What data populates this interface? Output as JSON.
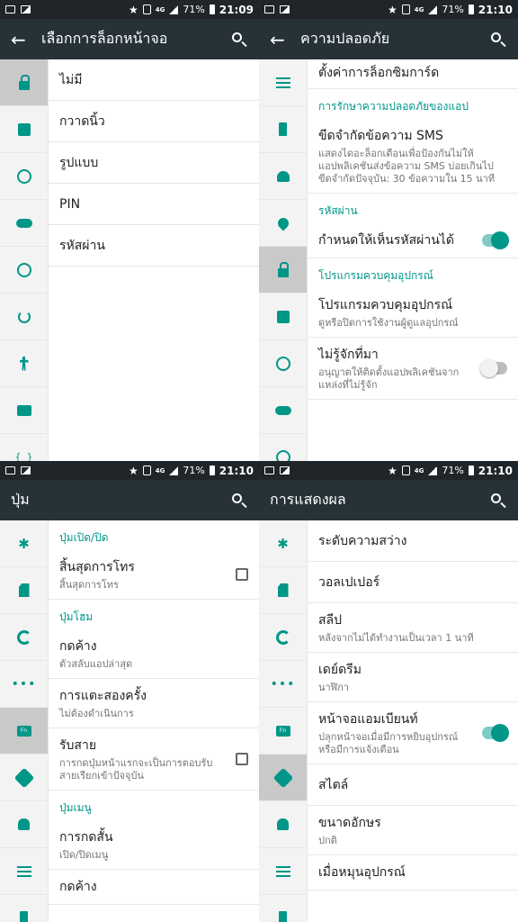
{
  "status": {
    "time": "21:09",
    "time2": "21:10",
    "battery": "71%",
    "net": "4G"
  },
  "screen1": {
    "title": "เลือกการล็อกหน้าจอ",
    "options": [
      "ไม่มี",
      "กวาดนิ้ว",
      "รูปแบบ",
      "PIN",
      "รหัสผ่าน"
    ]
  },
  "screen2": {
    "title": "ความปลอดภัย",
    "top_item": "ตั้งค่าการล็อกซิมการ์ด",
    "sec_app": "การรักษาความปลอดภัยของแอป",
    "sms_title": "ขีดจำกัดข้อความ SMS",
    "sms_sub": "แสดงไดอะล็อกเตือนเพื่อป้องกันไม่ให้แอปพลิเคชันส่งข้อความ SMS บ่อยเกินไป ขีดจำกัดปัจจุบัน: 30 ข้อความใน 15 นาที",
    "sec_pass": "รหัสผ่าน",
    "show_pass": "กำหนดให้เห็นรหัสผ่านได้",
    "sec_admin": "โปรแกรมควบคุมอุปกรณ์",
    "admin_title": "โปรแกรมควบคุมอุปกรณ์",
    "admin_sub": "ดูหรือปิดการใช้งานผู้ดูแลอุปกรณ์",
    "unknown_title": "ไม่รู้จักที่มา",
    "unknown_sub": "อนุญาตให้ติดตั้งแอปพลิเคชันจากแหล่งที่ไม่รู้จัก"
  },
  "screen3": {
    "title": "ปุ่ม",
    "sec_power": "ปุ่มเปิด/ปิด",
    "end_call": "สิ้นสุดการโทร",
    "end_call_sub": "สิ้นสุดการโทร",
    "sec_home": "ปุ่มโฮม",
    "long_press": "กดค้าง",
    "long_press_sub": "ตัวสลับแอปล่าสุด",
    "double_tap": "การแตะสองครั้ง",
    "double_tap_sub": "ไม่ต้องดำเนินการ",
    "answer": "รับสาย",
    "answer_sub": "การกดปุ่มหน้าแรกจะเป็นการตอบรับสายเรียกเข้าปัจจุบัน",
    "sec_menu": "ปุ่มเมนู",
    "short_press": "การกดสั้น",
    "short_press_sub": "เปิด/ปิดเมนู",
    "long_press2": "กดค้าง"
  },
  "screen4": {
    "title": "การแสดงผล",
    "brightness": "ระดับความสว่าง",
    "wallpaper": "วอลเปเปอร์",
    "sleep": "สลีป",
    "sleep_sub": "หลังจากไม่ได้ทำงานเป็นเวลา 1 นาที",
    "daydream": "เดย์ดรีม",
    "daydream_sub": "นาฬิกา",
    "ambient": "หน้าจอแอมเบียนท์",
    "ambient_sub": "ปลุกหน้าจอเมื่อมีการหยิบอุปกรณ์หรือมีการแจ้งเตือน",
    "style": "สไตล์",
    "font_size": "ขนาดอักษร",
    "font_size_sub": "ปกติ",
    "rotate": "เมื่อหมุนอุปกรณ์"
  }
}
